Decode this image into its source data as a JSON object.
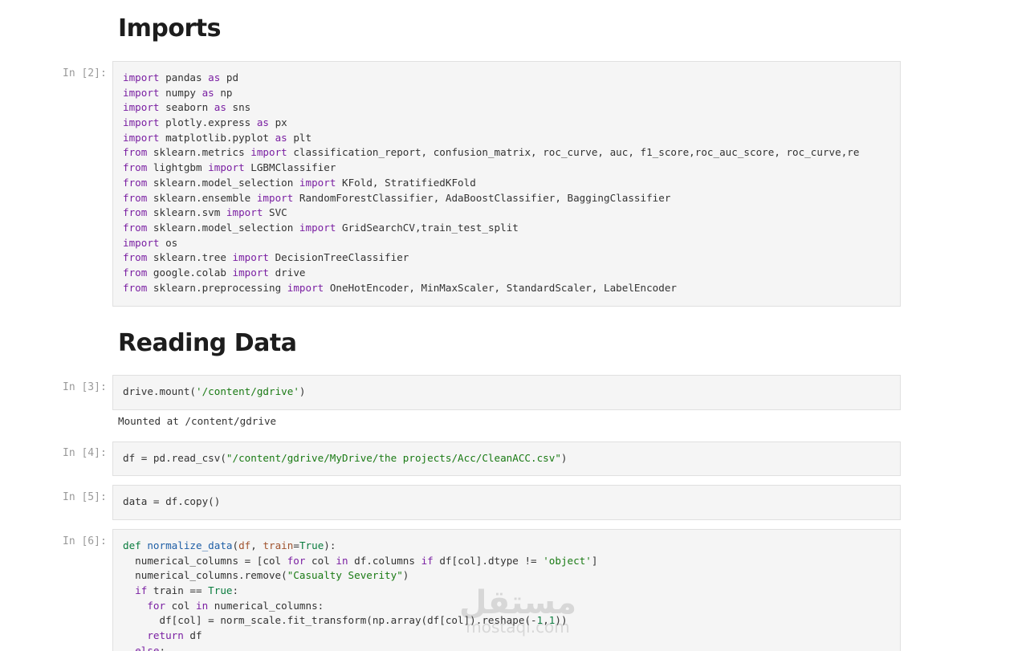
{
  "headings": {
    "imports": "Imports",
    "reading_data": "Reading Data"
  },
  "cells": {
    "c2": {
      "prompt": "In [2]:"
    },
    "c3": {
      "prompt": "In [3]:",
      "output": "Mounted at /content/gdrive"
    },
    "c4": {
      "prompt": "In [4]:"
    },
    "c5": {
      "prompt": "In [5]:"
    },
    "c6": {
      "prompt": "In [6]:"
    }
  },
  "code": {
    "c2": [
      [
        [
          "kw",
          "import"
        ],
        [
          "t",
          " pandas "
        ],
        [
          "kw",
          "as"
        ],
        [
          "t",
          " pd"
        ]
      ],
      [
        [
          "kw",
          "import"
        ],
        [
          "t",
          " numpy "
        ],
        [
          "kw",
          "as"
        ],
        [
          "t",
          " np"
        ]
      ],
      [
        [
          "kw",
          "import"
        ],
        [
          "t",
          " seaborn "
        ],
        [
          "kw",
          "as"
        ],
        [
          "t",
          " sns"
        ]
      ],
      [
        [
          "kw",
          "import"
        ],
        [
          "t",
          " plotly.express "
        ],
        [
          "kw",
          "as"
        ],
        [
          "t",
          " px"
        ]
      ],
      [
        [
          "kw",
          "import"
        ],
        [
          "t",
          " matplotlib.pyplot "
        ],
        [
          "kw",
          "as"
        ],
        [
          "t",
          " plt"
        ]
      ],
      [
        [
          "kw",
          "from"
        ],
        [
          "t",
          " sklearn.metrics "
        ],
        [
          "kw",
          "import"
        ],
        [
          "t",
          " classification_report, confusion_matrix, roc_curve, auc, f1_score,roc_auc_score, roc_curve,re"
        ]
      ],
      [
        [
          "kw",
          "from"
        ],
        [
          "t",
          " lightgbm "
        ],
        [
          "kw",
          "import"
        ],
        [
          "t",
          " LGBMClassifier"
        ]
      ],
      [
        [
          "kw",
          "from"
        ],
        [
          "t",
          " sklearn.model_selection "
        ],
        [
          "kw",
          "import"
        ],
        [
          "t",
          " KFold, StratifiedKFold"
        ]
      ],
      [
        [
          "kw",
          "from"
        ],
        [
          "t",
          " sklearn.ensemble "
        ],
        [
          "kw",
          "import"
        ],
        [
          "t",
          " RandomForestClassifier, AdaBoostClassifier, BaggingClassifier"
        ]
      ],
      [
        [
          "kw",
          "from"
        ],
        [
          "t",
          " sklearn.svm "
        ],
        [
          "kw",
          "import"
        ],
        [
          "t",
          " SVC"
        ]
      ],
      [
        [
          "kw",
          "from"
        ],
        [
          "t",
          " sklearn.model_selection "
        ],
        [
          "kw",
          "import"
        ],
        [
          "t",
          " GridSearchCV,train_test_split"
        ]
      ],
      [
        [
          "kw",
          "import"
        ],
        [
          "t",
          " os"
        ]
      ],
      [
        [
          "kw",
          "from"
        ],
        [
          "t",
          " sklearn.tree "
        ],
        [
          "kw",
          "import"
        ],
        [
          "t",
          " DecisionTreeClassifier"
        ]
      ],
      [
        [
          "kw",
          "from"
        ],
        [
          "t",
          " google.colab "
        ],
        [
          "kw",
          "import"
        ],
        [
          "t",
          " drive"
        ]
      ],
      [
        [
          "kw",
          "from"
        ],
        [
          "t",
          " sklearn.preprocessing "
        ],
        [
          "kw",
          "import"
        ],
        [
          "t",
          " OneHotEncoder, MinMaxScaler, StandardScaler, LabelEncoder"
        ]
      ]
    ],
    "c3": [
      [
        [
          "t",
          "drive.mount("
        ],
        [
          "str",
          "'/content/gdrive'"
        ],
        [
          "t",
          ")"
        ]
      ]
    ],
    "c4": [
      [
        [
          "t",
          "df = pd.read_csv("
        ],
        [
          "str",
          "\"/content/gdrive/MyDrive/the projects/Acc/CleanACC.csv\""
        ],
        [
          "t",
          ")"
        ]
      ]
    ],
    "c5": [
      [
        [
          "t",
          "data = df.copy()"
        ]
      ]
    ],
    "c6": [
      [
        [
          "kw2",
          "def"
        ],
        [
          "t",
          " "
        ],
        [
          "fn",
          "normalize_data"
        ],
        [
          "t",
          "("
        ],
        [
          "prm",
          "df"
        ],
        [
          "t",
          ", "
        ],
        [
          "prm",
          "train"
        ],
        [
          "t",
          "="
        ],
        [
          "cst",
          "True"
        ],
        [
          "t",
          "):"
        ]
      ],
      [
        [
          "t",
          "  numerical_columns = [col "
        ],
        [
          "kw",
          "for"
        ],
        [
          "t",
          " col "
        ],
        [
          "kw",
          "in"
        ],
        [
          "t",
          " df.columns "
        ],
        [
          "kw",
          "if"
        ],
        [
          "t",
          " df[col].dtype != "
        ],
        [
          "str",
          "'object'"
        ],
        [
          "t",
          "]"
        ]
      ],
      [
        [
          "t",
          "  numerical_columns.remove("
        ],
        [
          "str",
          "\"Casualty Severity\""
        ],
        [
          "t",
          ")"
        ]
      ],
      [
        [
          "t",
          "  "
        ],
        [
          "kw",
          "if"
        ],
        [
          "t",
          " train == "
        ],
        [
          "cst",
          "True"
        ],
        [
          "t",
          ":"
        ]
      ],
      [
        [
          "t",
          "    "
        ],
        [
          "kw",
          "for"
        ],
        [
          "t",
          " col "
        ],
        [
          "kw",
          "in"
        ],
        [
          "t",
          " numerical_columns:"
        ]
      ],
      [
        [
          "t",
          "      df[col] = norm_scale.fit_transform(np.array(df[col]).reshape(-"
        ],
        [
          "num",
          "1"
        ],
        [
          "t",
          ","
        ],
        [
          "num",
          "1"
        ],
        [
          "t",
          "))"
        ]
      ],
      [
        [
          "t",
          "    "
        ],
        [
          "kw",
          "return"
        ],
        [
          "t",
          " df"
        ]
      ],
      [
        [
          "t",
          "  "
        ],
        [
          "kw",
          "else"
        ],
        [
          "t",
          ":"
        ]
      ]
    ]
  },
  "watermark": {
    "arabic": "مستقل",
    "latin": "mostaql.com"
  }
}
